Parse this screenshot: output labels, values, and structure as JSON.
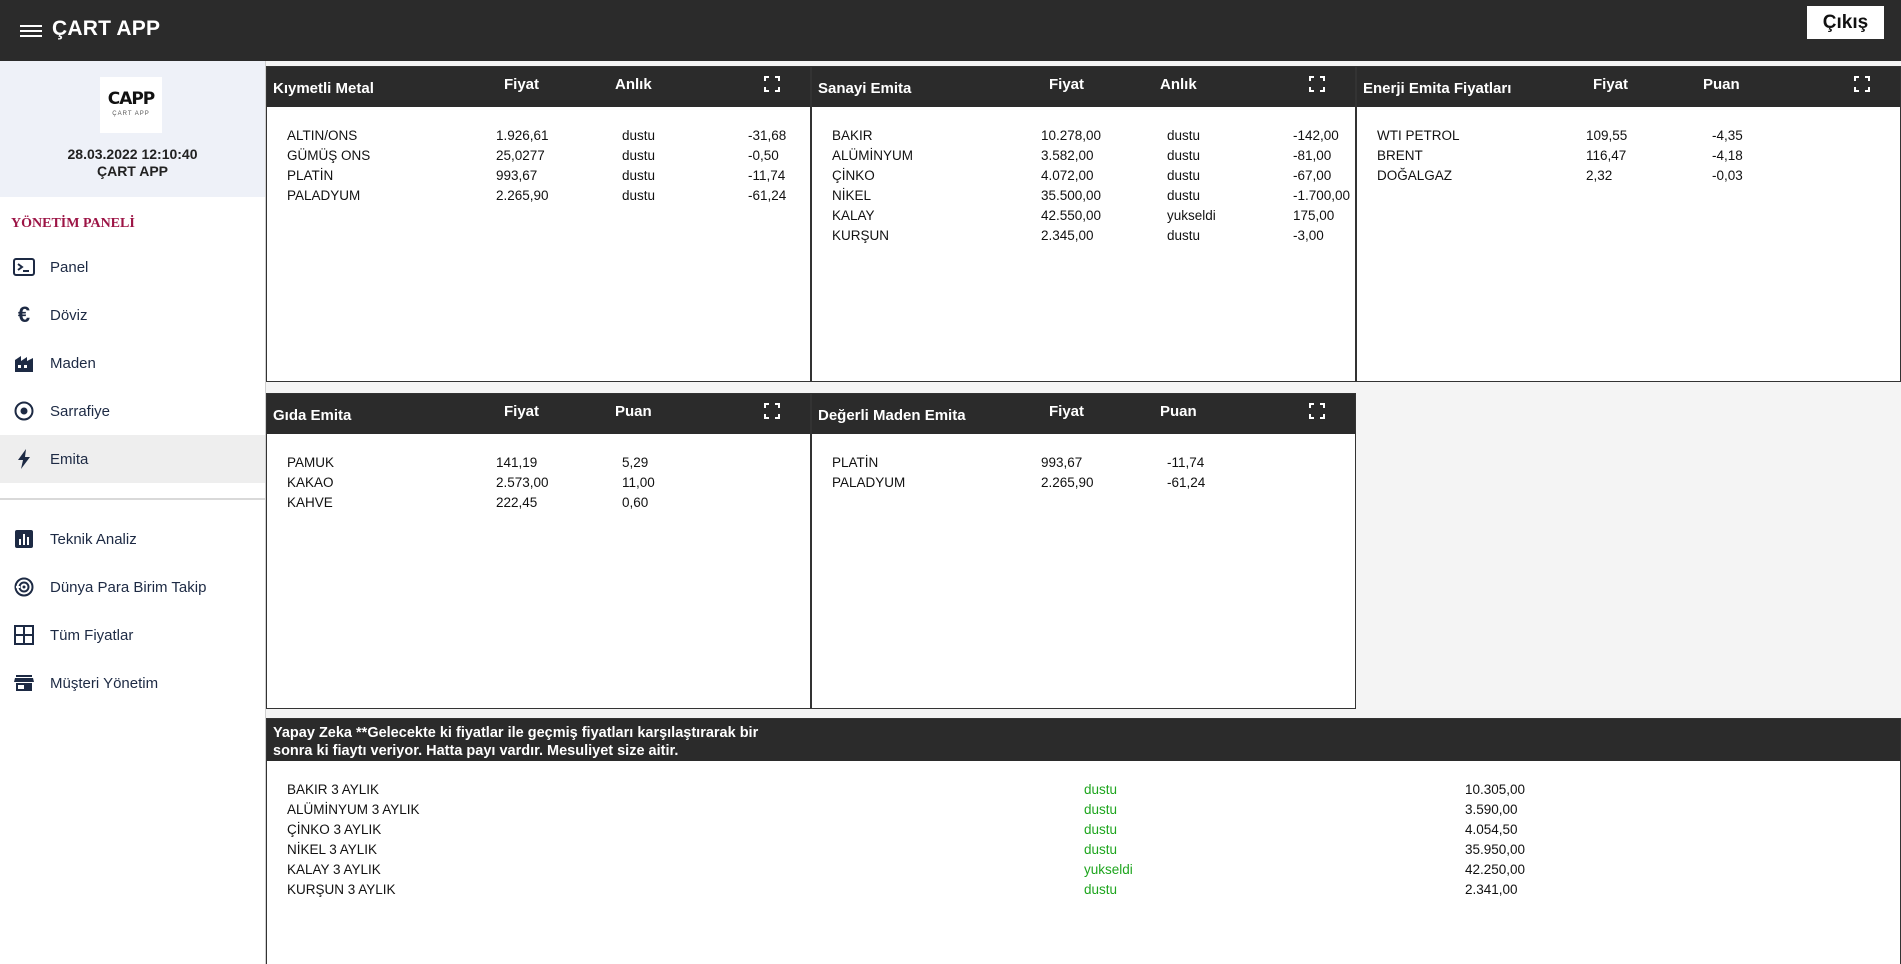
{
  "app": {
    "title": "ÇART APP",
    "logout_label": "Çıkış"
  },
  "profile": {
    "logo_text": "CAPP",
    "logo_sub": "ÇART APP",
    "datetime": "28.03.2022 12:10:40",
    "name": "ÇART APP"
  },
  "sidebar": {
    "heading": "YÖNETİM PANELİ",
    "items": [
      {
        "label": "Panel",
        "icon": "terminal-icon"
      },
      {
        "label": "Döviz",
        "icon": "euro-icon"
      },
      {
        "label": "Maden",
        "icon": "factory-icon"
      },
      {
        "label": "Sarrafiye",
        "icon": "coin-icon"
      },
      {
        "label": "Emita",
        "icon": "bolt-icon",
        "active": true
      }
    ],
    "items2": [
      {
        "label": "Teknik Analiz",
        "icon": "bar-chart-icon"
      },
      {
        "label": "Dünya Para Birim Takip",
        "icon": "track-icon"
      },
      {
        "label": "Tüm Fiyatlar",
        "icon": "grid-icon"
      },
      {
        "label": "Müşteri Yönetim",
        "icon": "store-icon"
      }
    ]
  },
  "cards": {
    "kiymetli": {
      "title": "Kıymetli Metal",
      "col1": "Fiyat",
      "col2": "Anlık",
      "rows": [
        {
          "name": "ALTIN/ONS",
          "price": "1.926,61",
          "status": "dustu",
          "change": "-31,68"
        },
        {
          "name": "GÜMÜŞ ONS",
          "price": "25,0277",
          "status": "dustu",
          "change": "-0,50"
        },
        {
          "name": "PLATİN",
          "price": "993,67",
          "status": "dustu",
          "change": "-11,74"
        },
        {
          "name": "PALADYUM",
          "price": "2.265,90",
          "status": "dustu",
          "change": "-61,24"
        }
      ]
    },
    "sanayi": {
      "title": "Sanayi Emita",
      "col1": "Fiyat",
      "col2": "Anlık",
      "rows": [
        {
          "name": "BAKIR",
          "price": "10.278,00",
          "status": "dustu",
          "change": "-142,00"
        },
        {
          "name": "ALÜMİNYUM",
          "price": "3.582,00",
          "status": "dustu",
          "change": "-81,00"
        },
        {
          "name": "ÇİNKO",
          "price": "4.072,00",
          "status": "dustu",
          "change": "-67,00"
        },
        {
          "name": "NİKEL",
          "price": "35.500,00",
          "status": "dustu",
          "change": "-1.700,00"
        },
        {
          "name": "KALAY",
          "price": "42.550,00",
          "status": "yukseldi",
          "change": "175,00"
        },
        {
          "name": "KURŞUN",
          "price": "2.345,00",
          "status": "dustu",
          "change": "-3,00"
        }
      ]
    },
    "enerji": {
      "title": "Enerji Emita Fiyatları",
      "col1": "Fiyat",
      "col2": "Puan",
      "rows": [
        {
          "name": "WTI PETROL",
          "price": "109,55",
          "change": "-4,35"
        },
        {
          "name": "BRENT",
          "price": "116,47",
          "change": "-4,18"
        },
        {
          "name": "DOĞALGAZ",
          "price": "2,32",
          "change": "-0,03"
        }
      ]
    },
    "gida": {
      "title": "Gıda Emita",
      "col1": "Fiyat",
      "col2": "Puan",
      "rows": [
        {
          "name": "PAMUK",
          "price": "141,19",
          "change": "5,29"
        },
        {
          "name": "KAKAO",
          "price": "2.573,00",
          "change": "11,00"
        },
        {
          "name": "KAHVE",
          "price": "222,45",
          "change": "0,60"
        }
      ]
    },
    "degerli": {
      "title": "Değerli Maden Emita",
      "col1": "Fiyat",
      "col2": "Puan",
      "rows": [
        {
          "name": "PLATİN",
          "price": "993,67",
          "change": "-11,74"
        },
        {
          "name": "PALADYUM",
          "price": "2.265,90",
          "change": "-61,24"
        }
      ]
    },
    "ai": {
      "title_line1": "Yapay Zeka **Gelecekte ki fiyatlar ile geçmiş fiyatları karşılaştırarak bir",
      "title_line2": "sonra ki fiaytı veriyor. Hatta payı vardır. Mesuliyet size aitir.",
      "rows": [
        {
          "name": "BAKIR 3 AYLIK",
          "status": "dustu",
          "price": "10.305,00"
        },
        {
          "name": "ALÜMİNYUM 3 AYLIK",
          "status": "dustu",
          "price": "3.590,00"
        },
        {
          "name": "ÇİNKO 3 AYLIK",
          "status": "dustu",
          "price": "4.054,50"
        },
        {
          "name": "NİKEL 3 AYLIK",
          "status": "dustu",
          "price": "35.950,00"
        },
        {
          "name": "KALAY 3 AYLIK",
          "status": "yukseldi",
          "price": "42.250,00"
        },
        {
          "name": "KURŞUN 3 AYLIK",
          "status": "dustu",
          "price": "2.341,00"
        }
      ]
    }
  }
}
